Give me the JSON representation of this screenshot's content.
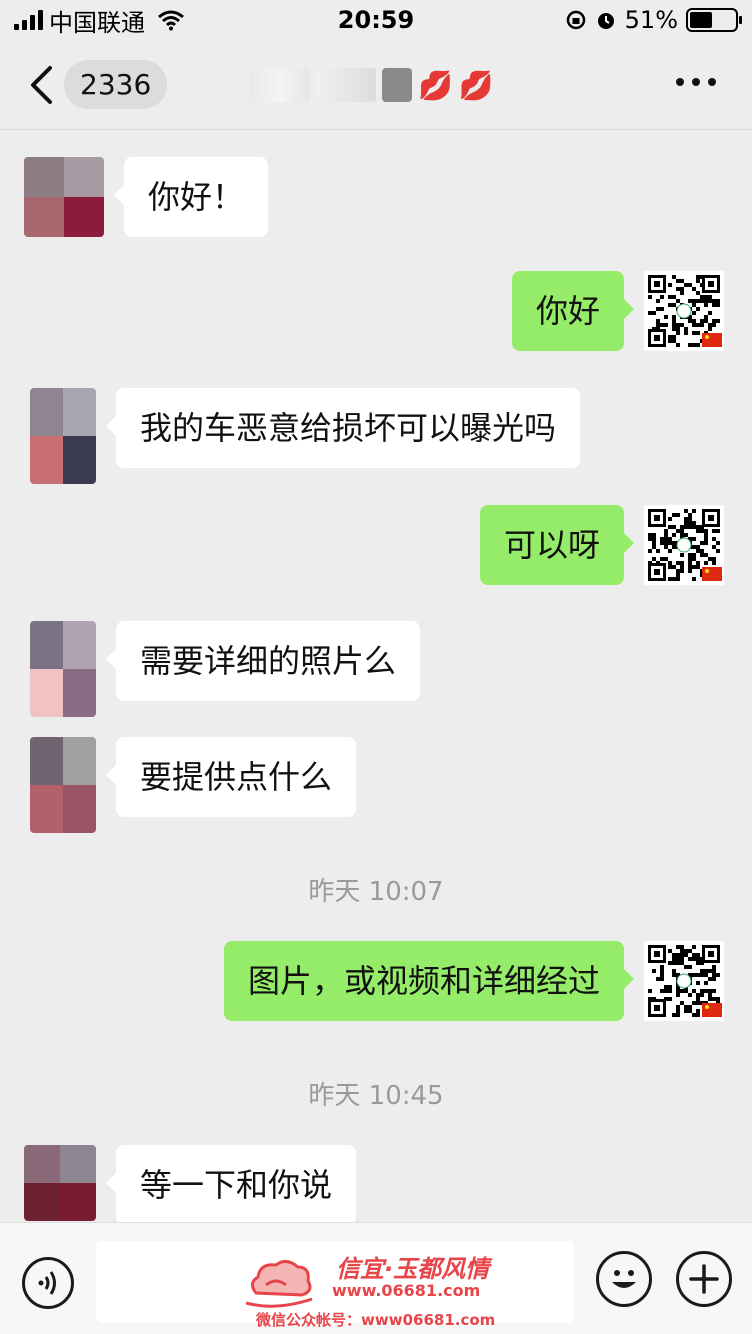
{
  "status_bar": {
    "carrier": "中国联通",
    "time": "20:59",
    "battery": "51%",
    "battery_level": 0.51
  },
  "nav": {
    "unread_count": "2336",
    "title_icons": [
      "lips-icon",
      "lips-icon"
    ]
  },
  "messages": [
    {
      "side": "left",
      "text": "你好！"
    },
    {
      "side": "right",
      "text": "你好"
    },
    {
      "side": "left",
      "text": "我的车恶意给损坏可以曝光吗"
    },
    {
      "side": "right",
      "text": "可以呀"
    },
    {
      "side": "left",
      "text": "需要详细的照片么"
    },
    {
      "side": "left",
      "text": "要提供点什么"
    },
    {
      "side": "right",
      "text": "图片，或视频和详细经过"
    },
    {
      "side": "left",
      "text": "等一下和你说"
    }
  ],
  "timestamps": [
    "昨天 10:07",
    "昨天 10:45"
  ],
  "watermark": {
    "title": "信宜·玉都风情",
    "url": "www.06681.com",
    "sub": "微信公众帐号：www06681.com"
  },
  "colors": {
    "bg": "#ededed",
    "bubble_right": "#95ec69",
    "bubble_left": "#ffffff",
    "watermark": "#e8454a"
  }
}
